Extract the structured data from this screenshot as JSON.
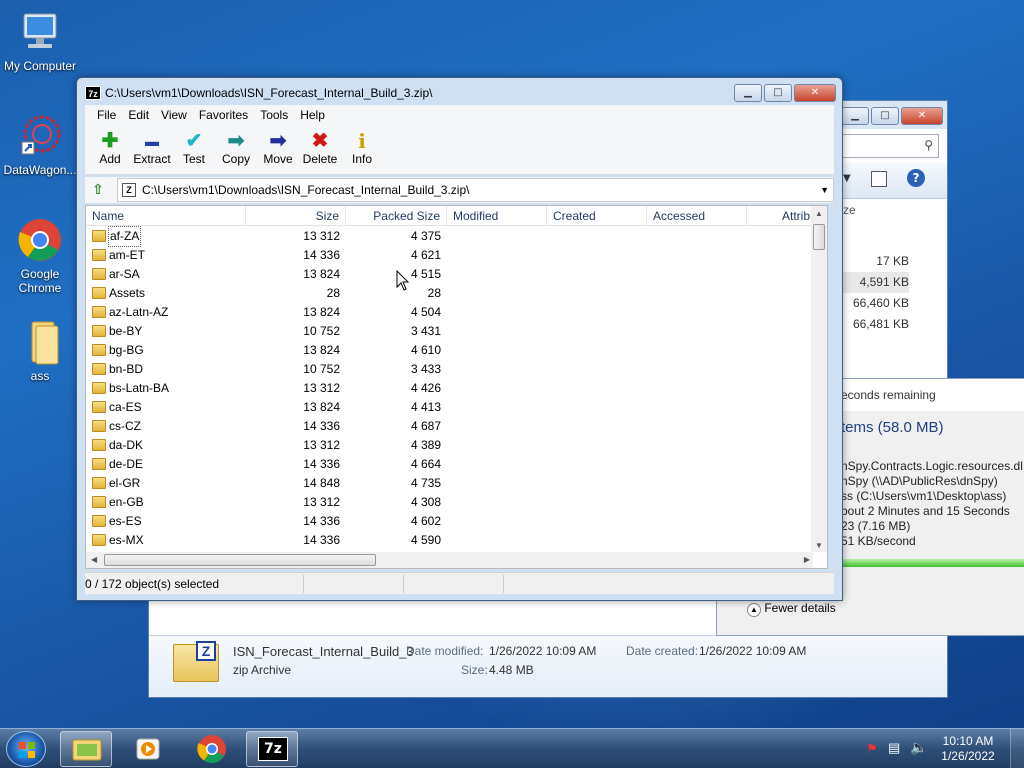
{
  "desktop": {
    "icons": [
      {
        "label": "My Computer"
      },
      {
        "label": "DataWagon..."
      },
      {
        "label": "Google Chrome"
      },
      {
        "label": "ass"
      }
    ]
  },
  "bg_explorer": {
    "column_fragment": "ze",
    "sizes": [
      "17 KB",
      "4,591 KB",
      "66,460 KB",
      "66,481 KB"
    ],
    "details": {
      "file_name": "ISN_Forecast_Internal_Build_3",
      "file_type": "zip Archive",
      "date_modified_label": "Date modified:",
      "date_modified": "1/26/2022 10:09 AM",
      "date_created_label": "Date created:",
      "date_created": "1/26/2022 10:09 AM",
      "size_label": "Size:",
      "size": "4.48 MB"
    }
  },
  "copy_dialog": {
    "time_remaining": "econds remaining",
    "items": "tems (58.0 MB)",
    "name_line": "nSpy.Contracts.Logic.resources.dl",
    "from_line": "nSpy (\\\\AD\\PublicRes\\dnSpy)",
    "to_line": "ss (C:\\Users\\vm1\\Desktop\\ass)",
    "time_line": "bout 2 Minutes and 15 Seconds",
    "items_left": "23 (7.16 MB)",
    "speed": "51 KB/second",
    "fewer_details": "Fewer details"
  },
  "zip_window": {
    "title": "C:\\Users\\vm1\\Downloads\\ISN_Forecast_Internal_Build_3.zip\\",
    "app_icon": "7z",
    "menu": [
      "File",
      "Edit",
      "View",
      "Favorites",
      "Tools",
      "Help"
    ],
    "toolbar": [
      {
        "label": "Add",
        "icon": "plus-icon",
        "glyph": "✚",
        "color": "#1e9d1e"
      },
      {
        "label": "Extract",
        "icon": "minus-icon",
        "glyph": "▬",
        "color": "#1f3fae"
      },
      {
        "label": "Test",
        "icon": "check-icon",
        "glyph": "✔",
        "color": "#22b7c7"
      },
      {
        "label": "Copy",
        "icon": "copy-arrow-icon",
        "glyph": "➡",
        "color": "#1b8a8a"
      },
      {
        "label": "Move",
        "icon": "move-arrow-icon",
        "glyph": "➡",
        "color": "#1f2f9e"
      },
      {
        "label": "Delete",
        "icon": "delete-x-icon",
        "glyph": "✖",
        "color": "#d01818"
      },
      {
        "label": "Info",
        "icon": "info-icon",
        "glyph": "i",
        "color": "#c9a200"
      }
    ],
    "address": "C:\\Users\\vm1\\Downloads\\ISN_Forecast_Internal_Build_3.zip\\",
    "columns": [
      "Name",
      "Size",
      "Packed Size",
      "Modified",
      "Created",
      "Accessed",
      "Attrib"
    ],
    "rows": [
      {
        "name": "af-ZA",
        "size": "13 312",
        "packed": "4 375"
      },
      {
        "name": "am-ET",
        "size": "14 336",
        "packed": "4 621"
      },
      {
        "name": "ar-SA",
        "size": "13 824",
        "packed": "4 515"
      },
      {
        "name": "Assets",
        "size": "28",
        "packed": "28"
      },
      {
        "name": "az-Latn-AZ",
        "size": "13 824",
        "packed": "4 504"
      },
      {
        "name": "be-BY",
        "size": "10 752",
        "packed": "3 431"
      },
      {
        "name": "bg-BG",
        "size": "13 824",
        "packed": "4 610"
      },
      {
        "name": "bn-BD",
        "size": "10 752",
        "packed": "3 433"
      },
      {
        "name": "bs-Latn-BA",
        "size": "13 312",
        "packed": "4 426"
      },
      {
        "name": "ca-ES",
        "size": "13 824",
        "packed": "4 413"
      },
      {
        "name": "cs-CZ",
        "size": "14 336",
        "packed": "4 687"
      },
      {
        "name": "da-DK",
        "size": "13 312",
        "packed": "4 389"
      },
      {
        "name": "de-DE",
        "size": "14 336",
        "packed": "4 664"
      },
      {
        "name": "el-GR",
        "size": "14 848",
        "packed": "4 735"
      },
      {
        "name": "en-GB",
        "size": "13 312",
        "packed": "4 308"
      },
      {
        "name": "es-ES",
        "size": "14 336",
        "packed": "4 602"
      },
      {
        "name": "es-MX",
        "size": "14 336",
        "packed": "4 590"
      }
    ],
    "status": "0 / 172 object(s) selected"
  },
  "taskbar": {
    "time": "10:10 AM",
    "date": "1/26/2022"
  }
}
